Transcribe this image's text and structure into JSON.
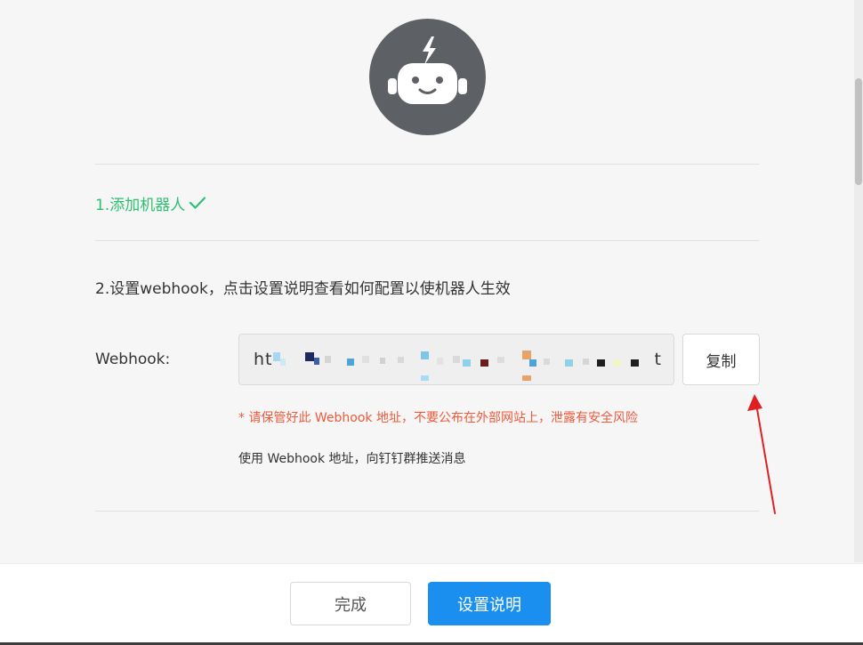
{
  "steps": {
    "step1_label": "1.添加机器人",
    "step1_check_icon": "checkmark-icon",
    "step2_label": "2.设置webhook，点击设置说明查看如何配置以使机器人生效"
  },
  "webhook": {
    "label": "Webhook:",
    "value_prefix": "ht",
    "value_suffix": "t",
    "value_obscured": true,
    "copy_label": "复制"
  },
  "notes": {
    "warning": "* 请保管好此 Webhook 地址，不要公布在外部网站上，泄露有安全风险",
    "hint": "使用 Webhook 地址，向钉钉群推送消息"
  },
  "footer": {
    "done_label": "完成",
    "help_label": "设置说明"
  },
  "colors": {
    "success": "#2fbf71",
    "warning": "#ef5a3b",
    "primary": "#1b8ff0",
    "avatar_bg": "#5d6165",
    "annotation_arrow": "#e02020"
  },
  "icons": {
    "avatar": "robot-avatar-icon",
    "annotation": "red-arrow-annotation"
  }
}
